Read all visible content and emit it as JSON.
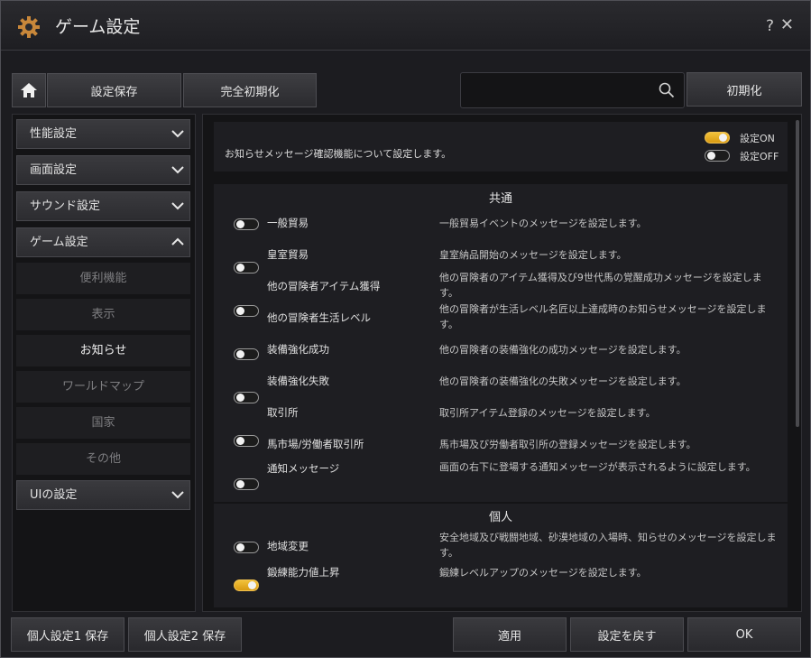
{
  "window": {
    "title": "ゲーム設定",
    "help_label": "?",
    "close_label": "✕"
  },
  "toolbar": {
    "home_icon": "home-icon",
    "save_label": "設定保存",
    "full_reset_label": "完全初期化",
    "search_placeholder": "",
    "search_value": "",
    "reset_label": "初期化"
  },
  "sidebar": {
    "categories": [
      {
        "label": "性能設定",
        "expanded": false
      },
      {
        "label": "画面設定",
        "expanded": false
      },
      {
        "label": "サウンド設定",
        "expanded": false
      },
      {
        "label": "ゲーム設定",
        "expanded": true
      },
      {
        "label": "UIの設定",
        "expanded": false
      }
    ],
    "game_subitems": [
      {
        "label": "便利機能",
        "active": false
      },
      {
        "label": "表示",
        "active": false
      },
      {
        "label": "お知らせ",
        "active": true
      },
      {
        "label": "ワールドマップ",
        "active": false
      },
      {
        "label": "国家",
        "active": false
      },
      {
        "label": "その他",
        "active": false
      }
    ]
  },
  "content": {
    "info_text": "お知らせメッセージ確認機能について設定します。",
    "legend_on": "設定ON",
    "legend_off": "設定OFF",
    "sections": [
      {
        "title": "共通",
        "rows": [
          {
            "label": "一般貿易",
            "on": false,
            "desc": "一般貿易イベントのメッセージを設定します。"
          },
          {
            "label": "皇室貿易",
            "on": false,
            "desc": "皇室納品開始のメッセージを設定します。"
          },
          {
            "label": "他の冒険者アイテム獲得",
            "on": false,
            "desc": "他の冒険者のアイテム獲得及び9世代馬の覚醒成功メッセージを設定します。"
          },
          {
            "label": "他の冒険者生活レベル",
            "on": false,
            "desc": "他の冒険者が生活レベル名匠以上達成時のお知らせメッセージを設定します。"
          },
          {
            "label": "装備強化成功",
            "on": false,
            "desc": "他の冒険者の装備強化の成功メッセージを設定します。"
          },
          {
            "label": "装備強化失敗",
            "on": false,
            "desc": "他の冒険者の装備強化の失敗メッセージを設定します。"
          },
          {
            "label": "取引所",
            "on": false,
            "desc": "取引所アイテム登録のメッセージを設定します。"
          },
          {
            "label": "馬市場/労働者取引所",
            "on": false,
            "desc": "馬市場及び労働者取引所の登録メッセージを設定します。"
          },
          {
            "label": "通知メッセージ",
            "on": true,
            "desc": "画面の右下に登場する通知メッセージが表示されるように設定します。"
          }
        ]
      },
      {
        "title": "個人",
        "rows": [
          {
            "label": "地域変更",
            "on": false,
            "desc": "安全地域及び戦闘地域、砂漠地域の入場時、知らせのメッセージを設定します。"
          },
          {
            "label": "鍛練能力値上昇",
            "on": true,
            "desc": "鍛練レベルアップのメッセージを設定します。"
          }
        ]
      }
    ]
  },
  "footer": {
    "preset1_label": "個人設定1 保存",
    "preset2_label": "個人設定2 保存",
    "apply_label": "適用",
    "revert_label": "設定を戻す",
    "ok_label": "OK"
  },
  "colors": {
    "toggle_on": "#f2c23a",
    "panel_bg": "#1e1e22"
  }
}
